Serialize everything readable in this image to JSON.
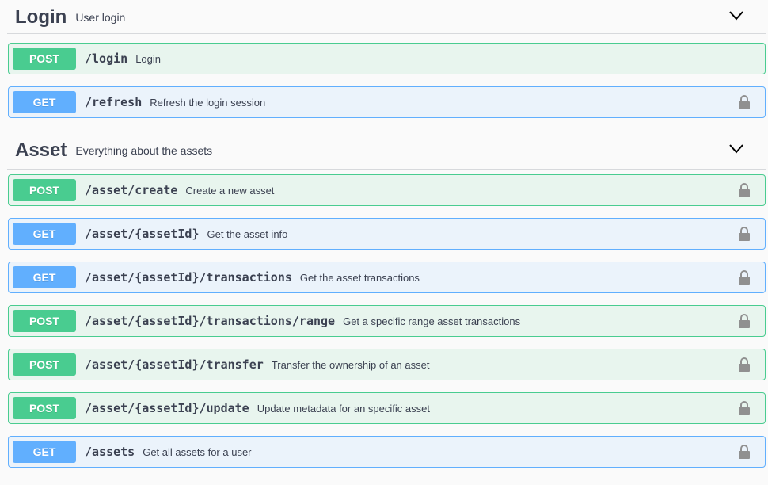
{
  "sections": [
    {
      "title": "Login",
      "description": "User login",
      "operations": [
        {
          "method": "POST",
          "path": "/login",
          "summary": "Login",
          "locked": false
        },
        {
          "method": "GET",
          "path": "/refresh",
          "summary": "Refresh the login session",
          "locked": true
        }
      ]
    },
    {
      "title": "Asset",
      "description": "Everything about the assets",
      "operations": [
        {
          "method": "POST",
          "path": "/asset/create",
          "summary": "Create a new asset",
          "locked": true
        },
        {
          "method": "GET",
          "path": "/asset/{assetId}",
          "summary": "Get the asset info",
          "locked": true
        },
        {
          "method": "GET",
          "path": "/asset/{assetId}/transactions",
          "summary": "Get the asset transactions",
          "locked": true
        },
        {
          "method": "POST",
          "path": "/asset/{assetId}/transactions/range",
          "summary": "Get a specific range asset transactions",
          "locked": true
        },
        {
          "method": "POST",
          "path": "/asset/{assetId}/transfer",
          "summary": "Transfer the ownership of an asset",
          "locked": true
        },
        {
          "method": "POST",
          "path": "/asset/{assetId}/update",
          "summary": "Update metadata for an specific asset",
          "locked": true
        },
        {
          "method": "GET",
          "path": "/assets",
          "summary": "Get all assets for a user",
          "locked": true
        }
      ]
    }
  ],
  "icons": {
    "collapse": "chevron-down-icon",
    "lock": "lock-icon"
  },
  "colors": {
    "post": "#49cc90",
    "post_bg": "#e8f5ee",
    "get": "#61affe",
    "get_bg": "#ebf3fb",
    "text": "#3b4151"
  }
}
